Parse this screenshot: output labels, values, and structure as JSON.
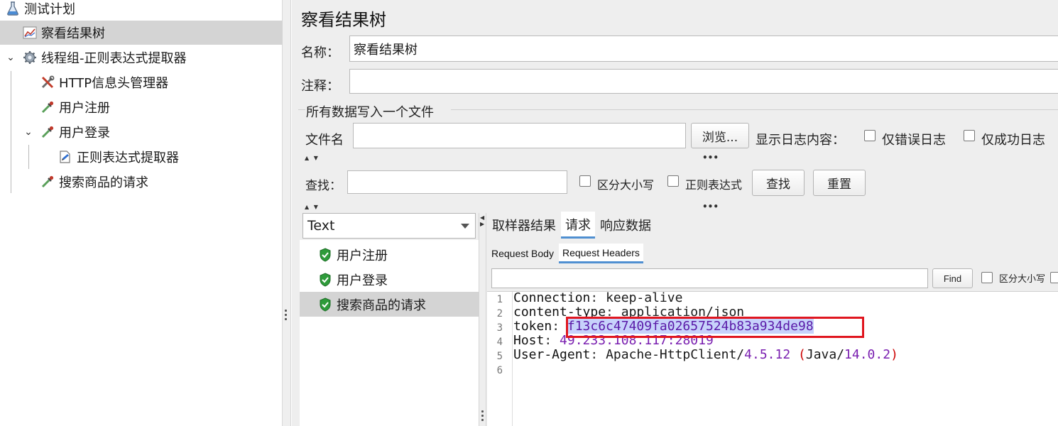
{
  "tree": {
    "items": [
      {
        "label": "测试计划"
      },
      {
        "label": "察看结果树"
      },
      {
        "label": "线程组-正则表达式提取器"
      },
      {
        "label": "HTTP信息头管理器"
      },
      {
        "label": "用户注册"
      },
      {
        "label": "用户登录"
      },
      {
        "label": "正则表达式提取器"
      },
      {
        "label": "搜索商品的请求"
      }
    ]
  },
  "panel": {
    "title": "察看结果树",
    "name_label": "名称：",
    "name_value": "察看结果树",
    "comment_label": "注释：",
    "comment_value": "",
    "file_section_title": "所有数据写入一个文件",
    "filename_label": "文件名",
    "filename_value": "",
    "browse_button": "浏览...",
    "log_content_label": "显示日志内容：",
    "errors_only_label": "仅错误日志",
    "success_only_label": "仅成功日志",
    "search_label": "查找：",
    "search_value": "",
    "case_sensitive_label": "区分大小写",
    "regex_label": "正则表达式",
    "find_button": "查找",
    "reset_button": "重置"
  },
  "results": {
    "renderer": "Text",
    "items": [
      {
        "label": "用户注册",
        "status": "success"
      },
      {
        "label": "用户登录",
        "status": "success"
      },
      {
        "label": "搜索商品的请求",
        "status": "success",
        "selected": true
      }
    ]
  },
  "detail": {
    "tabs": [
      {
        "label": "取样器结果"
      },
      {
        "label": "请求",
        "active": true
      },
      {
        "label": "响应数据"
      }
    ],
    "subtabs": [
      {
        "label": "Request Body"
      },
      {
        "label": "Request Headers",
        "active": true
      }
    ],
    "find_button": "Find",
    "case_sensitive_label": "区分大小写",
    "lines": [
      {
        "num": "1",
        "key": "Connection",
        "value": "keep-alive"
      },
      {
        "num": "2",
        "key": "content-type",
        "value": "application/json"
      },
      {
        "num": "3",
        "key": "token",
        "value": "f13c6c47409fa02657524b83a934de98"
      },
      {
        "num": "4",
        "key": "Host",
        "value": "49.233.108.117:28019"
      },
      {
        "num": "5",
        "key": "User-Agent",
        "value_a": "Apache-HttpClient/",
        "value_b": "4.5.12",
        "value_c": "(",
        "value_d": "Java/",
        "value_e": "14.0.2",
        "value_f": ")"
      },
      {
        "num": "6"
      }
    ]
  },
  "colors": {
    "accent_tab": "#4f8fd1",
    "highlight_box": "#e0161f",
    "success_shield": "#2e9b3a"
  }
}
